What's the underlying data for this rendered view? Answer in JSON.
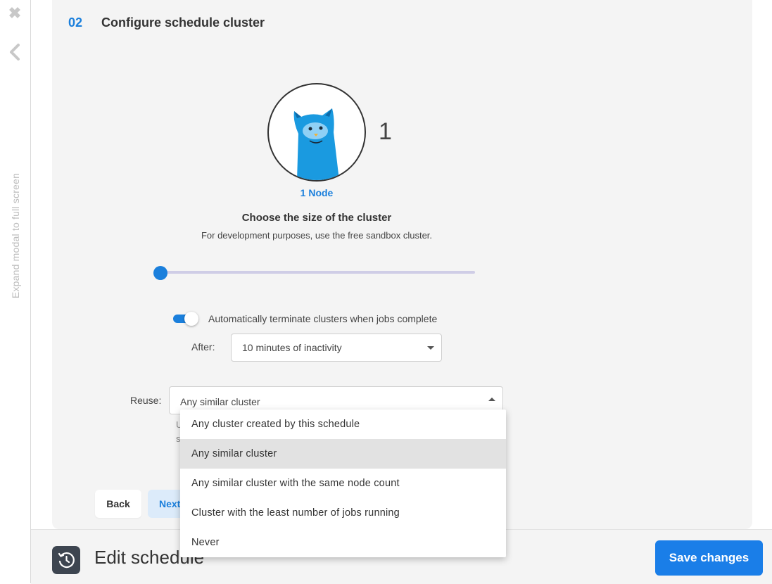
{
  "rail": {
    "expand_label": "Expand modal to full screen"
  },
  "step": {
    "number": "02",
    "title": "Configure schedule cluster"
  },
  "cluster": {
    "node_count": "1",
    "node_label": "1 Node",
    "size_title": "Choose the size of the cluster",
    "size_subtitle": "For development purposes, use the free sandbox cluster.",
    "slider_value": 1
  },
  "terminate": {
    "enabled": true,
    "label": "Automatically terminate clusters when jobs complete",
    "after_label": "After:",
    "after_value": "10 minutes of inactivity"
  },
  "reuse": {
    "label": "Reuse:",
    "value": "Any similar cluster",
    "help_partial_1": "U",
    "help_partial_2": "s",
    "options": [
      "Any cluster created by this schedule",
      "Any similar cluster",
      "Any similar cluster with the same node count",
      "Cluster with the least number of jobs running",
      "Never"
    ],
    "selected_index": 1
  },
  "nav": {
    "back_label": "Back",
    "next_label": "Next"
  },
  "footer": {
    "title": "Edit schedule",
    "save_label": "Save changes"
  },
  "colors": {
    "accent": "#1a7fdc",
    "save_button": "#1a7ee8",
    "avatar_cat": "#1a9ae0"
  },
  "icons": {
    "close": "close-icon",
    "back": "chevron-left-icon",
    "history": "history-icon",
    "caret": "caret-down-icon"
  }
}
